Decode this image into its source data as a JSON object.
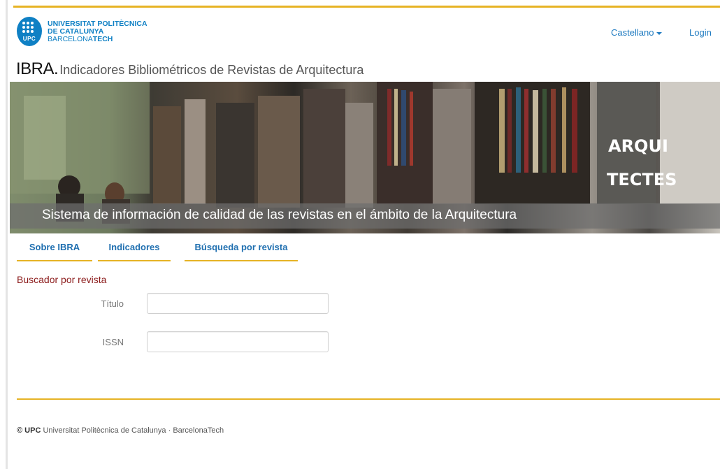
{
  "header": {
    "logo": {
      "line1": "UNIVERSITAT POLITÈCNICA",
      "line2": "DE CATALUNYA",
      "line3_a": "BARCELONA",
      "line3_b": "TECH",
      "badge_text": "UPC"
    },
    "language_label": "Castellano",
    "login_label": "Login"
  },
  "title": {
    "acronym": "IBRA.",
    "subtitle": "Indicadores Bibliométricos de Revistas de Arquitectura"
  },
  "banner": {
    "caption": "Sistema de información de calidad de las revistas en el ámbito de la Arquitectura",
    "sign_text_1": "ARQUI",
    "sign_text_2": "TECTES"
  },
  "tabs": [
    {
      "label": "Sobre IBRA"
    },
    {
      "label": "Indicadores"
    },
    {
      "label": "Búsqueda por revista"
    }
  ],
  "search": {
    "heading": "Buscador por revista",
    "fields": [
      {
        "label": "Título",
        "value": ""
      },
      {
        "label": "ISSN",
        "value": ""
      }
    ]
  },
  "footer": {
    "brand": "© UPC",
    "text": " Universitat Politècnica de Catalunya · BarcelonaTech"
  },
  "colors": {
    "accent_rule": "#e6b325",
    "link": "#1f7bc1",
    "section_heading": "#8b1a1a",
    "upc_blue": "#0f80c4"
  }
}
